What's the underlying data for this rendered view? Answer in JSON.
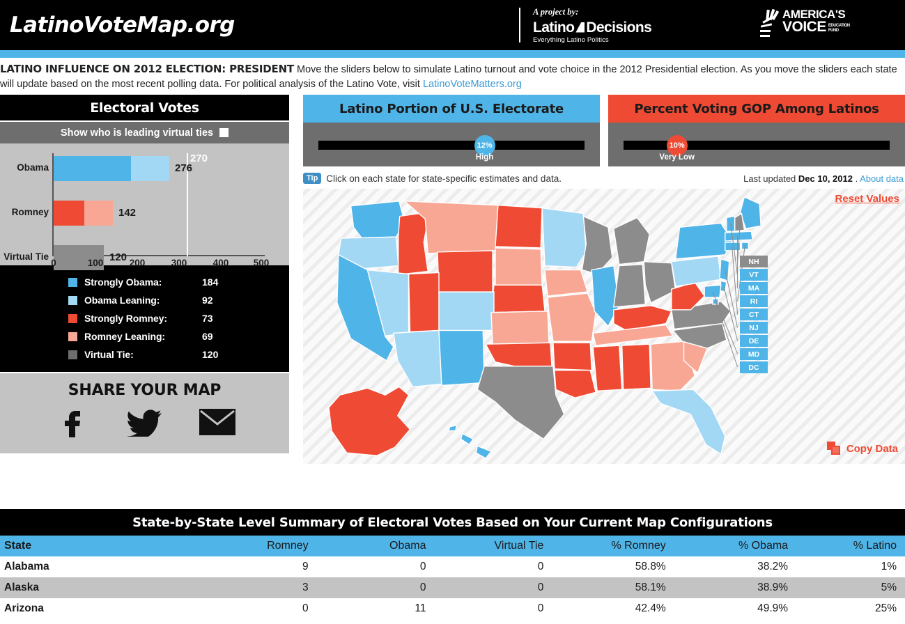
{
  "header": {
    "site_title": "LatinoVoteMap.org",
    "project_by": "A project by:",
    "partner_name_1": "Latino",
    "partner_name_2": "Decisions",
    "partner_tagline": "Everything Latino Politics",
    "sponsor_line1": "AMERICA'S",
    "sponsor_line2": "VOICE",
    "sponsor_sub1": "EDUCATION",
    "sponsor_sub2": "FUND"
  },
  "intro": {
    "headline": "LATINO INFLUENCE ON 2012 ELECTION: PRESIDENT",
    "body": " Move the sliders below to simulate Latino turnout and vote choice in the 2012 Presidential election. As you move the sliders each state will update based on the most recent polling data. For political analysis of the Latino Vote, visit ",
    "link": "LatinoVoteMatters.org"
  },
  "electoral": {
    "title": "Electoral Votes",
    "toggle_label": "Show who is leading virtual ties",
    "threshold": "270",
    "threshold_value": 270
  },
  "chart_data": {
    "type": "bar",
    "title": "Electoral Votes",
    "orientation": "horizontal",
    "categories": [
      "Obama",
      "Romney",
      "Virtual Tie"
    ],
    "values": [
      276,
      142,
      120
    ],
    "value_labels": [
      "276",
      "142",
      "120"
    ],
    "stacked_segments": [
      {
        "category": "Obama",
        "strong": 184,
        "leaning": 92,
        "strong_color": "#4fb4e8",
        "leaning_color": "#a3d8f4"
      },
      {
        "category": "Romney",
        "strong": 73,
        "leaning": 69,
        "strong_color": "#ef4a33",
        "leaning_color": "#f9a795"
      },
      {
        "category": "Virtual Tie",
        "strong": 120,
        "leaning": 0,
        "strong_color": "#8c8c8c",
        "leaning_color": "#8c8c8c"
      }
    ],
    "xlabel": "",
    "ylabel": "",
    "xlim": [
      0,
      500
    ],
    "xticks": [
      0,
      100,
      200,
      300,
      400,
      500
    ],
    "xtick_labels": [
      "0",
      "100",
      "200",
      "300",
      "400",
      "500"
    ],
    "threshold_line": 270,
    "threshold_label": "270",
    "grid": false,
    "legend_position": "below"
  },
  "legend": {
    "items": [
      {
        "label": "Strongly Obama:",
        "value": "184",
        "color": "#4fb4e8"
      },
      {
        "label": "Obama Leaning:",
        "value": "92",
        "color": "#a3d8f4"
      },
      {
        "label": "Strongly Romney:",
        "value": "73",
        "color": "#ef4a33"
      },
      {
        "label": "Romney Leaning:",
        "value": "69",
        "color": "#f9a795"
      },
      {
        "label": "Virtual Tie:",
        "value": "120",
        "color": "#6e6e6e"
      }
    ]
  },
  "share": {
    "title": "SHARE YOUR MAP",
    "icons": [
      "facebook-icon",
      "twitter-icon",
      "email-icon"
    ]
  },
  "sliders": [
    {
      "title": "Latino Portion of U.S. Electorate",
      "value": "12%",
      "caption": "High",
      "percent": 56,
      "header_color": "#4fb4e8",
      "knob_color": "#4fb4e8"
    },
    {
      "title": "Percent Voting GOP Among Latinos",
      "value": "10%",
      "caption": "Very Low",
      "percent": 18,
      "header_color": "#ef4a33",
      "knob_color": "#ef4a33"
    }
  ],
  "tip": {
    "badge": "Tip",
    "text": "Click on each state for state-specific estimates and data."
  },
  "updated": {
    "prefix": "Last updated ",
    "date": "Dec 10, 2012",
    "sep": " . ",
    "link": "About data"
  },
  "map": {
    "reset_label": "Reset Values",
    "copy_label": "Copy Data",
    "callout_states": [
      {
        "abbr": "NH",
        "color": "#8c8c8c"
      },
      {
        "abbr": "VT",
        "color": "#4fb4e8"
      },
      {
        "abbr": "MA",
        "color": "#4fb4e8"
      },
      {
        "abbr": "RI",
        "color": "#4fb4e8"
      },
      {
        "abbr": "CT",
        "color": "#4fb4e8"
      },
      {
        "abbr": "NJ",
        "color": "#4fb4e8"
      },
      {
        "abbr": "DE",
        "color": "#4fb4e8"
      },
      {
        "abbr": "MD",
        "color": "#4fb4e8"
      },
      {
        "abbr": "DC",
        "color": "#4fb4e8"
      }
    ]
  },
  "table": {
    "title": "State-by-State Level Summary of Electoral Votes Based on Your Current Map Configurations",
    "columns": [
      "State",
      "Romney",
      "Obama",
      "Virtual Tie",
      "% Romney",
      "% Obama",
      "% Latino"
    ],
    "rows": [
      [
        "Alabama",
        "9",
        "0",
        "0",
        "58.8%",
        "38.2%",
        "1%"
      ],
      [
        "Alaska",
        "3",
        "0",
        "0",
        "58.1%",
        "38.9%",
        "5%"
      ],
      [
        "Arizona",
        "0",
        "11",
        "0",
        "42.4%",
        "49.9%",
        "25%"
      ]
    ]
  },
  "colors": {
    "strong_obama": "#4fb4e8",
    "obama_leaning": "#a3d8f4",
    "strong_romney": "#ef4a33",
    "romney_leaning": "#f9a795",
    "virtual_tie": "#8c8c8c"
  }
}
